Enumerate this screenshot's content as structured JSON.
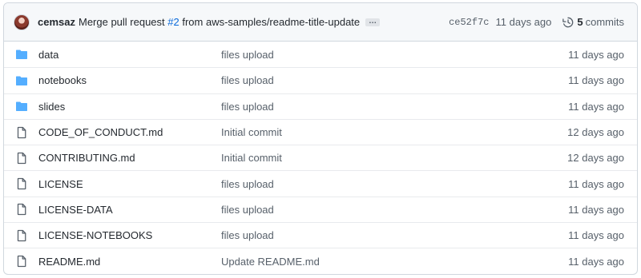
{
  "commit": {
    "author": "cemsaz",
    "message_prefix": "Merge pull request ",
    "pr_link": "#2",
    "message_suffix": " from aws-samples/readme-title-update",
    "ellipsis": "…",
    "sha": "ce52f7c",
    "time": "11 days ago",
    "commits_count": "5",
    "commits_label": "commits"
  },
  "colors": {
    "folder": "#54aeff",
    "link": "#0969da",
    "muted": "#57606a"
  },
  "files": [
    {
      "type": "folder",
      "icon": "folder-icon",
      "name": "data",
      "message": "files upload",
      "age": "11 days ago"
    },
    {
      "type": "folder",
      "icon": "folder-icon",
      "name": "notebooks",
      "message": "files upload",
      "age": "11 days ago"
    },
    {
      "type": "folder",
      "icon": "folder-icon",
      "name": "slides",
      "message": "files upload",
      "age": "11 days ago"
    },
    {
      "type": "file",
      "icon": "file-icon",
      "name": "CODE_OF_CONDUCT.md",
      "message": "Initial commit",
      "age": "12 days ago"
    },
    {
      "type": "file",
      "icon": "file-icon",
      "name": "CONTRIBUTING.md",
      "message": "Initial commit",
      "age": "12 days ago"
    },
    {
      "type": "file",
      "icon": "file-icon",
      "name": "LICENSE",
      "message": "files upload",
      "age": "11 days ago"
    },
    {
      "type": "file",
      "icon": "file-icon",
      "name": "LICENSE-DATA",
      "message": "files upload",
      "age": "11 days ago"
    },
    {
      "type": "file",
      "icon": "file-icon",
      "name": "LICENSE-NOTEBOOKS",
      "message": "files upload",
      "age": "11 days ago"
    },
    {
      "type": "file",
      "icon": "file-icon",
      "name": "README.md",
      "message": "Update README.md",
      "age": "11 days ago"
    }
  ]
}
